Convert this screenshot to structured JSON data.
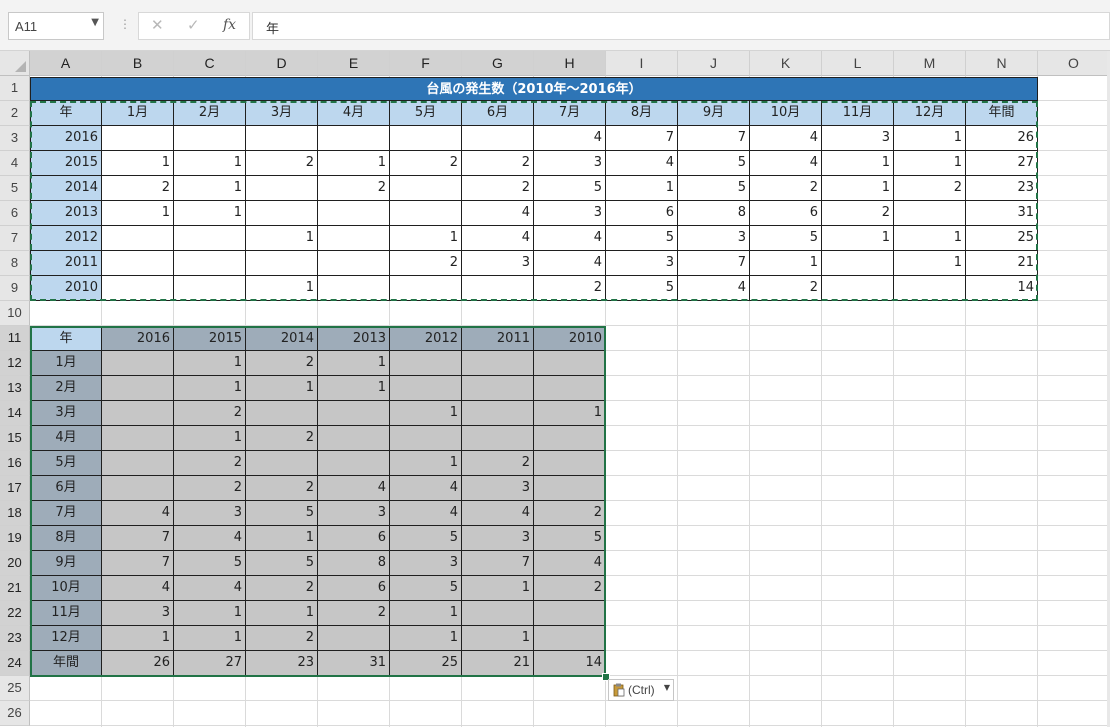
{
  "name_box": "A11",
  "formula_bar": {
    "cancel_icon": "close-icon",
    "enter_icon": "check-icon",
    "fx_label": "fx",
    "content": "年"
  },
  "columns": [
    "A",
    "B",
    "C",
    "D",
    "E",
    "F",
    "G",
    "H",
    "I",
    "J",
    "K",
    "L",
    "M",
    "N",
    "O"
  ],
  "rows": [
    "1",
    "2",
    "3",
    "4",
    "5",
    "6",
    "7",
    "8",
    "9",
    "10",
    "11",
    "12",
    "13",
    "14",
    "15",
    "16",
    "17",
    "18",
    "19",
    "20",
    "21",
    "22",
    "23",
    "24",
    "25",
    "26"
  ],
  "table1": {
    "title": "台風の発生数（2010年～2016年）",
    "header": [
      "年",
      "1月",
      "2月",
      "3月",
      "4月",
      "5月",
      "6月",
      "7月",
      "8月",
      "9月",
      "10月",
      "11月",
      "12月",
      "年間"
    ],
    "rows": [
      [
        "2016",
        "",
        "",
        "",
        "",
        "",
        "",
        "4",
        "7",
        "7",
        "4",
        "3",
        "1",
        "26"
      ],
      [
        "2015",
        "1",
        "1",
        "2",
        "1",
        "2",
        "2",
        "3",
        "4",
        "5",
        "4",
        "1",
        "1",
        "27"
      ],
      [
        "2014",
        "2",
        "1",
        "",
        "2",
        "",
        "2",
        "5",
        "1",
        "5",
        "2",
        "1",
        "2",
        "23"
      ],
      [
        "2013",
        "1",
        "1",
        "",
        "",
        "",
        "4",
        "3",
        "6",
        "8",
        "6",
        "2",
        "",
        "31"
      ],
      [
        "2012",
        "",
        "",
        "1",
        "",
        "1",
        "4",
        "4",
        "5",
        "3",
        "5",
        "1",
        "1",
        "25"
      ],
      [
        "2011",
        "",
        "",
        "",
        "",
        "2",
        "3",
        "4",
        "3",
        "7",
        "1",
        "",
        "1",
        "21"
      ],
      [
        "2010",
        "",
        "",
        "1",
        "",
        "",
        "",
        "2",
        "5",
        "4",
        "2",
        "",
        "",
        "14"
      ]
    ]
  },
  "table2": {
    "header": [
      "年",
      "2016",
      "2015",
      "2014",
      "2013",
      "2012",
      "2011",
      "2010"
    ],
    "rows": [
      [
        "1月",
        "",
        "1",
        "2",
        "1",
        "",
        "",
        ""
      ],
      [
        "2月",
        "",
        "1",
        "1",
        "1",
        "",
        "",
        ""
      ],
      [
        "3月",
        "",
        "2",
        "",
        "",
        "1",
        "",
        "1"
      ],
      [
        "4月",
        "",
        "1",
        "2",
        "",
        "",
        "",
        ""
      ],
      [
        "5月",
        "",
        "2",
        "",
        "",
        "1",
        "2",
        ""
      ],
      [
        "6月",
        "",
        "2",
        "2",
        "4",
        "4",
        "3",
        ""
      ],
      [
        "7月",
        "4",
        "3",
        "5",
        "3",
        "4",
        "4",
        "2"
      ],
      [
        "8月",
        "7",
        "4",
        "1",
        "6",
        "5",
        "3",
        "5"
      ],
      [
        "9月",
        "7",
        "5",
        "5",
        "8",
        "3",
        "7",
        "4"
      ],
      [
        "10月",
        "4",
        "4",
        "2",
        "6",
        "5",
        "1",
        "2"
      ],
      [
        "11月",
        "3",
        "1",
        "1",
        "2",
        "1",
        "",
        ""
      ],
      [
        "12月",
        "1",
        "1",
        "2",
        "",
        "1",
        "1",
        ""
      ],
      [
        "年間",
        "26",
        "27",
        "23",
        "31",
        "25",
        "21",
        "14"
      ]
    ]
  },
  "paste_options": {
    "label": "(Ctrl)"
  },
  "colors": {
    "title_fill": "#2e75b6",
    "header_fill": "#bdd7ee",
    "year_fill": "#bdd7ee",
    "pasted_fill": "#c6c6c6",
    "pasted_header_fill": "#9eacb9",
    "selection": "#217346"
  }
}
